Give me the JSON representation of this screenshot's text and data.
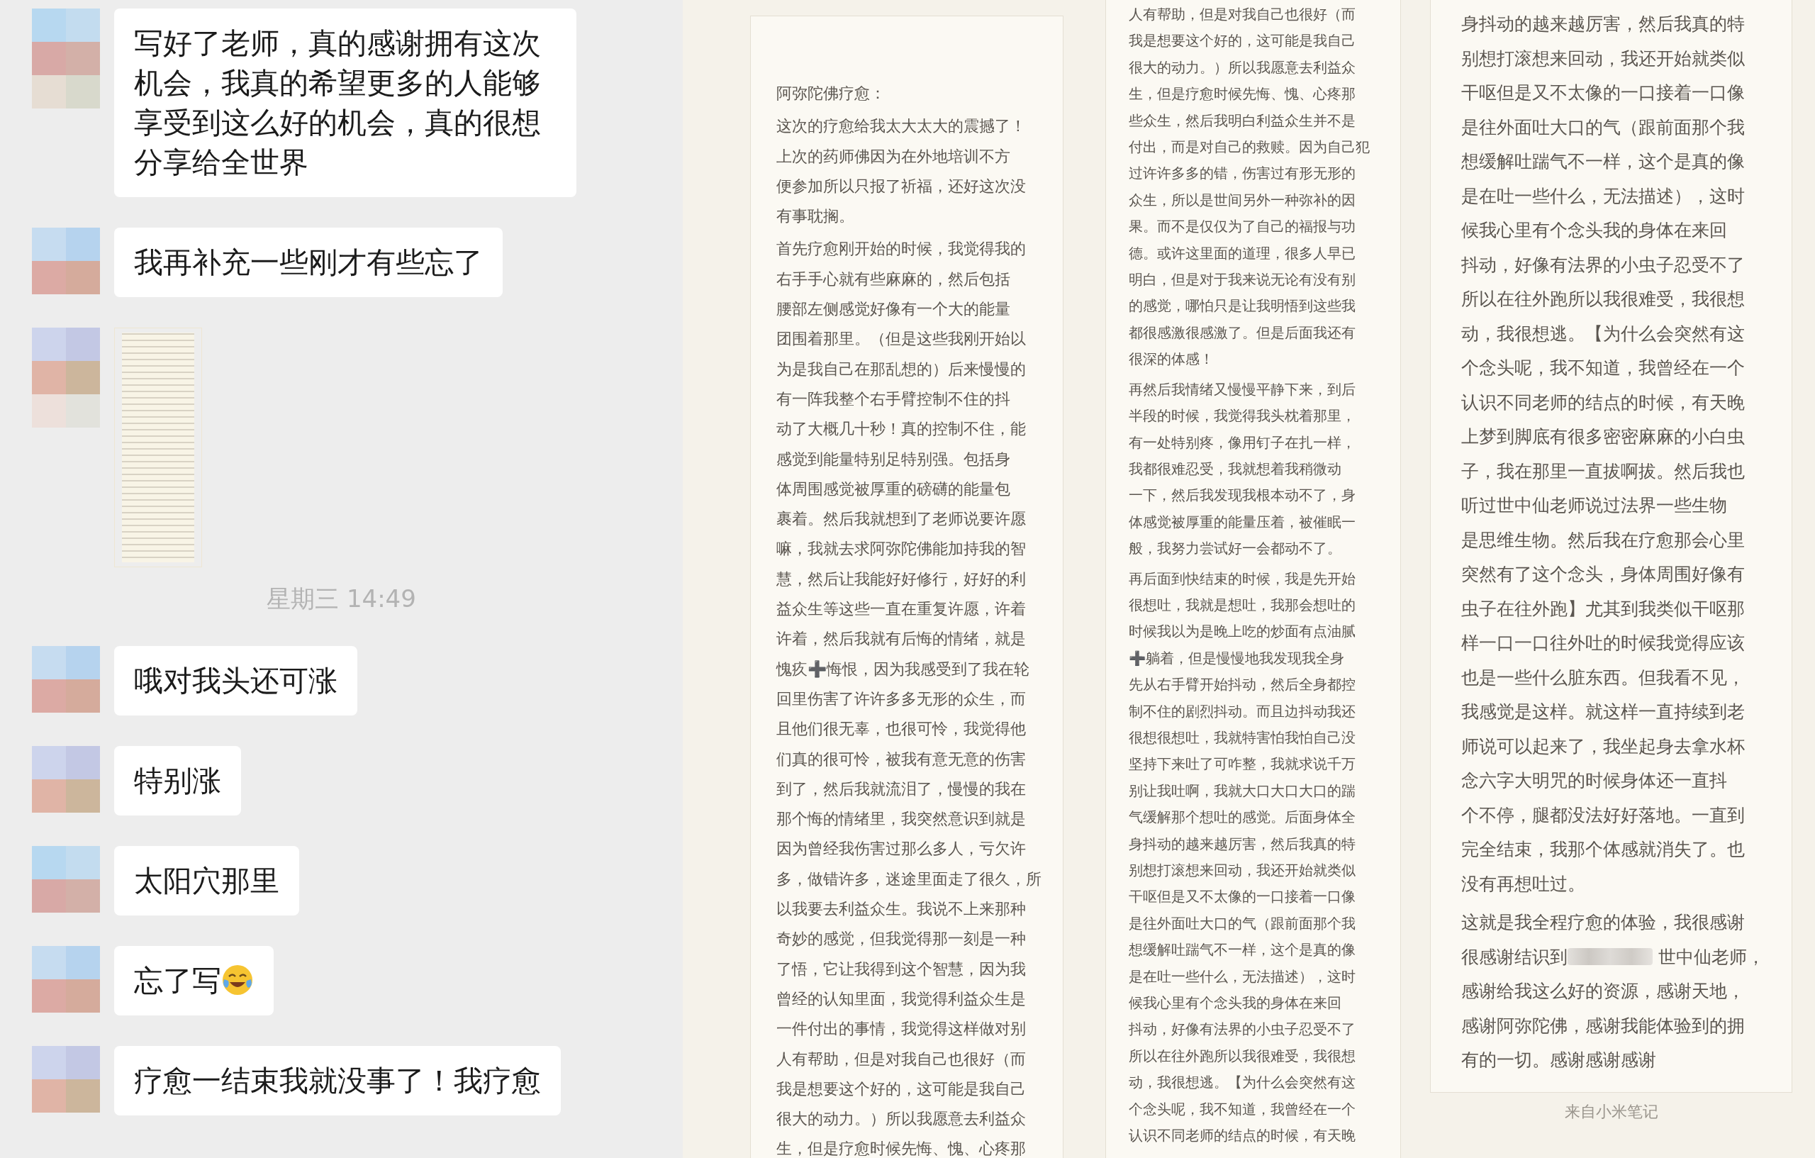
{
  "chat": {
    "messages": [
      {
        "kind": "text",
        "text": "写好了老师，真的感谢拥有这次机会，我真的希望更多的人能够享受到这么好的机会，真的很想分享给全世界"
      },
      {
        "kind": "text",
        "text": "我再补充一些刚才有些忘了"
      },
      {
        "kind": "image"
      },
      {
        "kind": "time",
        "text": "星期三 14:49"
      },
      {
        "kind": "text",
        "text": "哦对我头还可涨"
      },
      {
        "kind": "text",
        "text": "特别涨"
      },
      {
        "kind": "text",
        "text": "太阳穴那里"
      },
      {
        "kind": "text",
        "text": "忘了写",
        "emoji": true
      },
      {
        "kind": "text",
        "text": "疗愈一结束我就没事了！我疗愈"
      }
    ]
  },
  "notes": [
    {
      "title": "阿弥陀佛疗愈：",
      "paragraphs": [
        {
          "lines": [
            "这次的疗愈给我太大太大的震撼了！",
            "上次的药师佛因为在外地培训不方",
            "便参加所以只报了祈福，还好这次没",
            "有事耽搁。"
          ]
        },
        {
          "lines": [
            "首先疗愈刚开始的时候，我觉得我的",
            "右手手心就有些麻麻的，然后包括",
            "腰部左侧感觉好像有一个大的能量",
            "团围着那里。（但是这些我刚开始以",
            "为是我自己在那乱想的）后来慢慢的",
            "有一阵我整个右手臂控制不住的抖",
            "动了大概几十秒！真的控制不住，能",
            "感觉到能量特别足特别强。包括身",
            "体周围感觉被厚重的磅礴的能量包",
            "裹着。然后我就想到了老师说要许愿",
            "嘛，我就去求阿弥陀佛能加持我的智",
            "慧，然后让我能好好修行，好好的利",
            "益众生等这些一直在重复许愿，许着",
            "许着，然后我就有后悔的情绪，就是",
            "愧疚➕悔恨，因为我感受到了我在轮",
            "回里伤害了许许多多无形的众生，而",
            "且他们很无辜，也很可怜，我觉得他",
            "们真的很可怜，被我有意无意的伤害",
            "到了，然后我就流泪了，慢慢的我在",
            "那个悔的情绪里，我突然意识到就是",
            "因为曾经我伤害过那么多人，亏欠许",
            "多，做错许多，迷途里面走了很久，所",
            "以我要去利益众生。我说不上来那种",
            "奇妙的感觉，但我觉得那一刻是一种",
            "了悟，它让我得到这个智慧，因为我",
            "曾经的认知里面，我觉得利益众生是",
            "一件付出的事情，我觉得这样做对别",
            "人有帮助，但是对我自己也很好（而",
            "我是想要这个好的，这可能是我自己",
            "很大的动力。）所以我愿意去利益众",
            "生，但是疗愈时候先悔、愧、心疼那"
          ]
        }
      ]
    },
    {
      "paragraphs": [
        {
          "lines": [
            "人有帮助，但是对我自己也很好（而",
            "我是想要这个好的，这可能是我自己",
            "很大的动力。）所以我愿意去利益众",
            "生，但是疗愈时候先悔、愧、心疼那",
            "些众生，然后我明白利益众生并不是",
            "付出，而是对自己的救赎。因为自己犯",
            "过许许多多的错，伤害过有形无形的",
            "众生，所以是世间另外一种弥补的因",
            "果。而不是仅仅为了自己的福报与功",
            "德。或许这里面的道理，很多人早已",
            "明白，但是对于我来说无论有没有别",
            "的感觉，哪怕只是让我明悟到这些我",
            "都很感激很感激了。但是后面我还有",
            "很深的体感！"
          ]
        },
        {
          "lines": [
            "再然后我情绪又慢慢平静下来，到后",
            "半段的时候，我觉得我头枕着那里，",
            "有一处特别疼，像用钉子在扎一样，",
            "我都很难忍受，我就想着我稍微动",
            "一下，然后我发现我根本动不了，身",
            "体感觉被厚重的能量压着，被催眠一",
            "般，我努力尝试好一会都动不了。"
          ]
        },
        {
          "lines": [
            "再后面到快结束的时候，我是先开始",
            "很想吐，我就是想吐，我那会想吐的",
            "时候我以为是晚上吃的炒面有点油腻",
            "➕躺着，但是慢慢地我发现我全身",
            "先从右手臂开始抖动，然后全身都控",
            "制不住的剧烈抖动。而且边抖动我还",
            "很想很想吐，我就特害怕我怕自己没",
            "坚持下来吐了可咋整，我就求说千万",
            "别让我吐啊，我就大口大口大口的踹",
            "气缓解那个想吐的感觉。后面身体全",
            "身抖动的越来越厉害，然后我真的特",
            "别想打滚想来回动，我还开始就类似",
            "干呕但是又不太像的一口接着一口像",
            "是往外面吐大口的气（跟前面那个我",
            "想缓解吐踹气不一样，这个是真的像",
            "是在吐一些什么，无法描述），这时",
            "候我心里有个念头我的身体在来回",
            "抖动，好像有法界的小虫子忍受不了",
            "所以在往外跑所以我很难受，我很想",
            "动，我很想逃。【为什么会突然有这",
            "个念头呢，我不知道，我曾经在一个",
            "认识不同老师的结点的时候，有天晚"
          ]
        }
      ]
    },
    {
      "paragraphs": [
        {
          "lines": [
            "身抖动的越来越厉害，然后我真的特",
            "别想打滚想来回动，我还开始就类似",
            "干呕但是又不太像的一口接着一口像",
            "是往外面吐大口的气（跟前面那个我",
            "想缓解吐踹气不一样，这个是真的像",
            "是在吐一些什么，无法描述），这时",
            "候我心里有个念头我的身体在来回",
            "抖动，好像有法界的小虫子忍受不了",
            "所以在往外跑所以我很难受，我很想",
            "动，我很想逃。【为什么会突然有这",
            "个念头呢，我不知道，我曾经在一个",
            "认识不同老师的结点的时候，有天晚",
            "上梦到脚底有很多密密麻麻的小白虫",
            "子，我在那里一直拔啊拔。然后我也",
            "听过世中仙老师说过法界一些生物",
            "是思维生物。然后我在疗愈那会心里",
            "突然有了这个念头，身体周围好像有",
            "虫子在往外跑】尤其到我类似干呕那",
            "样一口一口往外吐的时候我觉得应该",
            "也是一些什么脏东西。但我看不见，",
            "我感觉是这样。就这样一直持续到老",
            "师说可以起来了，我坐起身去拿水杯",
            "念六字大明咒的时候身体还一直抖",
            "个不停，腿都没法好好落地。一直到",
            "完全结束，我那个体感就消失了。也",
            "没有再想吐过。"
          ]
        },
        {
          "lines": [
            "这就是我全程疗愈的体验，我很感谢",
            [
              "很感谢结识到",
              "世中仙老师，"
            ],
            "感谢给我这么好的资源，感谢天地，",
            "感谢阿弥陀佛，感谢我能体验到的拥",
            "有的一切。感谢感谢感谢"
          ]
        }
      ],
      "footer": "来自小米笔记"
    }
  ]
}
